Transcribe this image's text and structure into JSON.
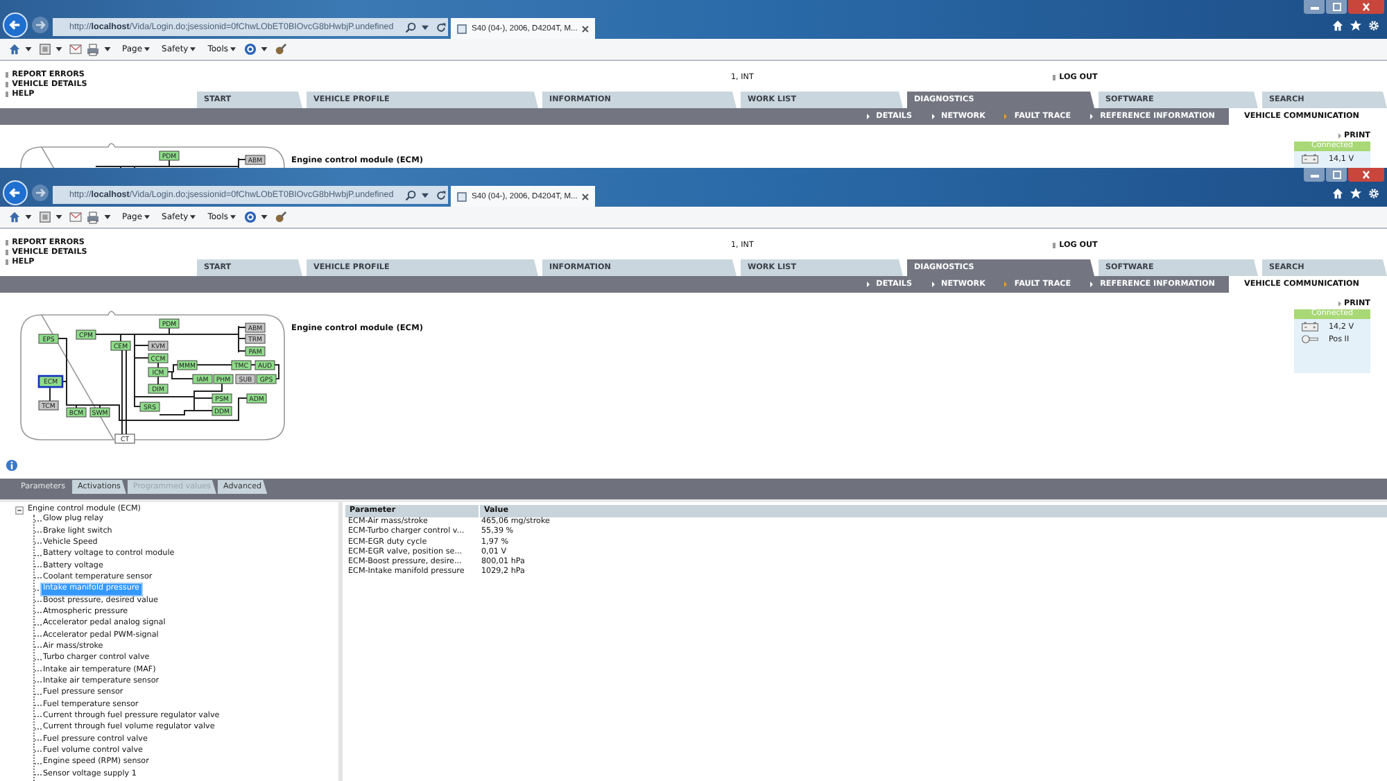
{
  "windows": [
    {
      "address": "http://**localhost**/Vida/Login.do;jsessionid=0fChwLObET0BIOvcG8bHwbjP.undefined",
      "tab_title": "S40 (04-), 2006, D4204T, M...",
      "menus": [
        "Page",
        "Safety",
        "Tools"
      ],
      "links": [
        "REPORT ERRORS",
        "VEHICLE DETAILS",
        "HELP"
      ],
      "user": "1, INT",
      "logout": "LOG OUT",
      "tabs": [
        {
          "label": "START",
          "selected": false
        },
        {
          "label": "VEHICLE PROFILE",
          "selected": false
        },
        {
          "label": "INFORMATION",
          "selected": false
        },
        {
          "label": "WORK LIST",
          "selected": false
        },
        {
          "label": "DIAGNOSTICS",
          "selected": true
        },
        {
          "label": "SOFTWARE",
          "selected": false
        },
        {
          "label": "SEARCH",
          "selected": false
        }
      ],
      "subnav": [
        {
          "label": "DETAILS",
          "selected": false
        },
        {
          "label": "NETWORK",
          "selected": false
        },
        {
          "label": "FAULT TRACE",
          "selected": true
        },
        {
          "label": "REFERENCE INFORMATION",
          "selected": false
        }
      ],
      "section": "VEHICLE COMMUNICATION",
      "print": "PRINT",
      "connection": {
        "status": "Connected",
        "readings": [
          {
            "kind": "battery",
            "text": "14,1 V"
          }
        ]
      },
      "module_title": "Engine control module (ECM)",
      "diagram": {
        "nodes": [
          {
            "label": "PDM",
            "kind": "ok",
            "selected": false
          },
          {
            "label": "ABM",
            "kind": "absent",
            "selected": false
          }
        ]
      }
    },
    {
      "address": "http://**localhost**/Vida/Login.do;jsessionid=0fChwLObET0BIOvcG8bHwbjP.undefined",
      "tab_title": "S40 (04-), 2006, D4204T, M...",
      "menus": [
        "Page",
        "Safety",
        "Tools"
      ],
      "links": [
        "REPORT ERRORS",
        "VEHICLE DETAILS",
        "HELP"
      ],
      "user": "1, INT",
      "logout": "LOG OUT",
      "tabs": [
        {
          "label": "START",
          "selected": false
        },
        {
          "label": "VEHICLE PROFILE",
          "selected": false
        },
        {
          "label": "INFORMATION",
          "selected": false
        },
        {
          "label": "WORK LIST",
          "selected": false
        },
        {
          "label": "DIAGNOSTICS",
          "selected": true
        },
        {
          "label": "SOFTWARE",
          "selected": false
        },
        {
          "label": "SEARCH",
          "selected": false
        }
      ],
      "subnav": [
        {
          "label": "DETAILS",
          "selected": false
        },
        {
          "label": "NETWORK",
          "selected": false
        },
        {
          "label": "FAULT TRACE",
          "selected": true
        },
        {
          "label": "REFERENCE INFORMATION",
          "selected": false
        }
      ],
      "section": "VEHICLE COMMUNICATION",
      "print": "PRINT",
      "connection": {
        "status": "Connected",
        "readings": [
          {
            "kind": "battery",
            "text": "14,2 V"
          },
          {
            "kind": "key",
            "text": "Pos II"
          }
        ]
      },
      "module_title": "Engine control module (ECM)",
      "diagram": {
        "nodes": [
          {
            "label": "PDM",
            "kind": "ok",
            "selected": false
          },
          {
            "label": "ABM",
            "kind": "absent",
            "selected": false
          },
          {
            "label": "EPS",
            "kind": "ok",
            "selected": false
          },
          {
            "label": "CPM",
            "kind": "ok",
            "selected": false
          },
          {
            "label": "TRM",
            "kind": "absent",
            "selected": false
          },
          {
            "label": "CEM",
            "kind": "ok",
            "selected": false
          },
          {
            "label": "KVM",
            "kind": "absent",
            "selected": false
          },
          {
            "label": "PAM",
            "kind": "ok",
            "selected": false
          },
          {
            "label": "CCM",
            "kind": "ok",
            "selected": false
          },
          {
            "label": "MMM",
            "kind": "ok",
            "selected": false
          },
          {
            "label": "TMC",
            "kind": "ok",
            "selected": false
          },
          {
            "label": "AUD",
            "kind": "ok",
            "selected": false
          },
          {
            "label": "ICM",
            "kind": "ok",
            "selected": false
          },
          {
            "label": "ECM",
            "kind": "ok",
            "selected": true
          },
          {
            "label": "IAM",
            "kind": "ok",
            "selected": false
          },
          {
            "label": "PHM",
            "kind": "ok",
            "selected": false
          },
          {
            "label": "SUB",
            "kind": "absent",
            "selected": false
          },
          {
            "label": "GPS",
            "kind": "ok",
            "selected": false
          },
          {
            "label": "DIM",
            "kind": "ok",
            "selected": false
          },
          {
            "label": "PSM",
            "kind": "ok",
            "selected": false
          },
          {
            "label": "ADM",
            "kind": "ok",
            "selected": false
          },
          {
            "label": "TCM",
            "kind": "absent",
            "selected": false
          },
          {
            "label": "BCM",
            "kind": "ok",
            "selected": false
          },
          {
            "label": "SWM",
            "kind": "ok",
            "selected": false
          },
          {
            "label": "SRS",
            "kind": "ok",
            "selected": false
          },
          {
            "label": "DDM",
            "kind": "ok",
            "selected": false
          },
          {
            "label": "CT",
            "kind": "external",
            "selected": false
          }
        ]
      },
      "lower_tabs": [
        {
          "label": "Parameters",
          "selected": true,
          "disabled": false
        },
        {
          "label": "Activations",
          "selected": false,
          "disabled": false
        },
        {
          "label": "Programmed values",
          "selected": false,
          "disabled": true
        },
        {
          "label": "Advanced",
          "selected": false,
          "disabled": false
        }
      ],
      "tree": {
        "label": "Engine control module (ECM)",
        "expanded": true,
        "children": [
          {
            "label": "Glow plug relay",
            "selected": false
          },
          {
            "label": "Brake light switch",
            "selected": false
          },
          {
            "label": "Vehicle Speed",
            "selected": false
          },
          {
            "label": "Battery voltage to control module",
            "selected": false
          },
          {
            "label": "Battery voltage",
            "selected": false
          },
          {
            "label": "Coolant temperature sensor",
            "selected": false
          },
          {
            "label": "Intake manifold pressure",
            "selected": true
          },
          {
            "label": "Boost pressure, desired value",
            "selected": false
          },
          {
            "label": "Atmospheric pressure",
            "selected": false
          },
          {
            "label": "Accelerator pedal analog signal",
            "selected": false
          },
          {
            "label": "Accelerator pedal PWM-signal",
            "selected": false
          },
          {
            "label": "Air mass/stroke",
            "selected": false
          },
          {
            "label": "Turbo charger control valve",
            "selected": false
          },
          {
            "label": "Intake air temperature (MAF)",
            "selected": false
          },
          {
            "label": "Intake air temperature sensor",
            "selected": false
          },
          {
            "label": "Fuel pressure sensor",
            "selected": false
          },
          {
            "label": "Fuel temperature sensor",
            "selected": false
          },
          {
            "label": "Current through fuel pressure regulator valve",
            "selected": false
          },
          {
            "label": "Current through fuel volume regulator valve",
            "selected": false
          },
          {
            "label": "Fuel pressure control valve",
            "selected": false
          },
          {
            "label": "Fuel volume control valve",
            "selected": false
          },
          {
            "label": "Engine speed (RPM) sensor",
            "selected": false
          },
          {
            "label": "Sensor voltage supply 1",
            "selected": false
          }
        ]
      },
      "table": {
        "columns": [
          "Parameter",
          "Value"
        ],
        "rows": [
          [
            "ECM-Air mass/stroke",
            "465,06 mg/stroke"
          ],
          [
            "ECM-Turbo charger control v...",
            "55,39 %"
          ],
          [
            "ECM-EGR duty cycle",
            "1,97 %"
          ],
          [
            "ECM-EGR valve, position se...",
            "0,01 V"
          ],
          [
            "ECM-Boost pressure, desire...",
            "800,01 hPa"
          ],
          [
            "ECM-Intake manifold pressure",
            "1029,2 hPa"
          ]
        ]
      }
    }
  ]
}
